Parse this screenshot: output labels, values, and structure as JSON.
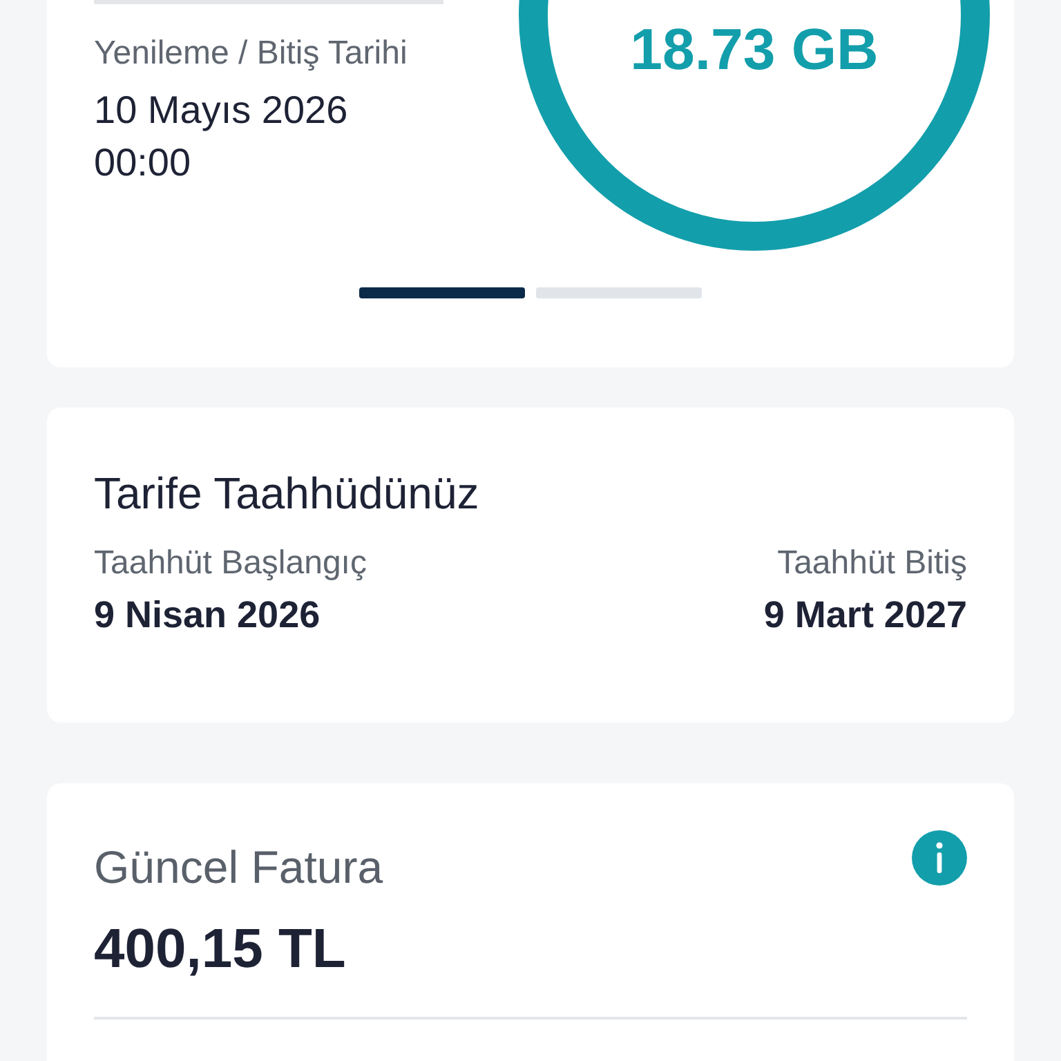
{
  "usage_card": {
    "renewal": {
      "label": "Yenileme / Bitiş Tarihi",
      "date": "10 Mayıs 2026",
      "time": "00:00"
    },
    "remaining": "18.73 GB",
    "pages": [
      {
        "selected": true
      },
      {
        "selected": false
      }
    ]
  },
  "commitment": {
    "title": "Tarife Taahhüdünüz",
    "start_label": "Taahhüt Başlangıç",
    "start_value": "9 Nisan 2026",
    "end_label": "Taahhüt Bitiş",
    "end_value": "9 Mart 2027"
  },
  "bill": {
    "title": "Güncel Fatura",
    "amount": "400,15 TL"
  }
}
